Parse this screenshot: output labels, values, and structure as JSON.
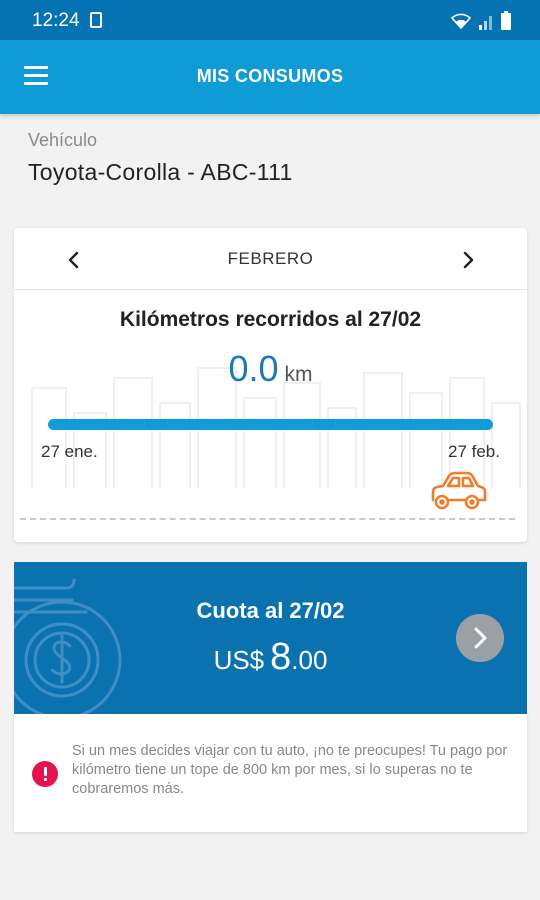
{
  "status_bar": {
    "time": "12:24"
  },
  "app_bar": {
    "title": "MIS CONSUMOS"
  },
  "vehicle": {
    "label": "Vehículo",
    "value": "Toyota-Corolla - ABC-111"
  },
  "km_card": {
    "month": "FEBRERO",
    "title": "Kilómetros recorridos al 27/02",
    "km_value": "0.0",
    "km_unit": "km",
    "progress": 1.0,
    "start_date": "27 ene.",
    "end_date": "27 feb."
  },
  "quota_card": {
    "title": "Cuota al 27/02",
    "currency": "US$",
    "amount_int": "8",
    "amount_dec": ".00"
  },
  "info_card": {
    "text": "Si un mes decides viajar con tu auto, ¡no te preocupes! Tu pago por kilómetro tiene un tope de 800 km por mes, si lo superas no te cobraremos más."
  },
  "colors": {
    "status_bar": "#0572b4",
    "app_bar": "#0f9bd6",
    "accent": "#119bd8",
    "quota_bg": "#0b72b0",
    "car_orange": "#ef7d2a",
    "info_red": "#e2134d"
  },
  "icons": [
    "menu-icon",
    "chevron-left-icon",
    "chevron-right-icon",
    "car-icon",
    "dollar-coin-icon",
    "arrow-right-icon",
    "info-icon",
    "wifi-icon",
    "signal-icon",
    "battery-icon",
    "sim-icon"
  ]
}
